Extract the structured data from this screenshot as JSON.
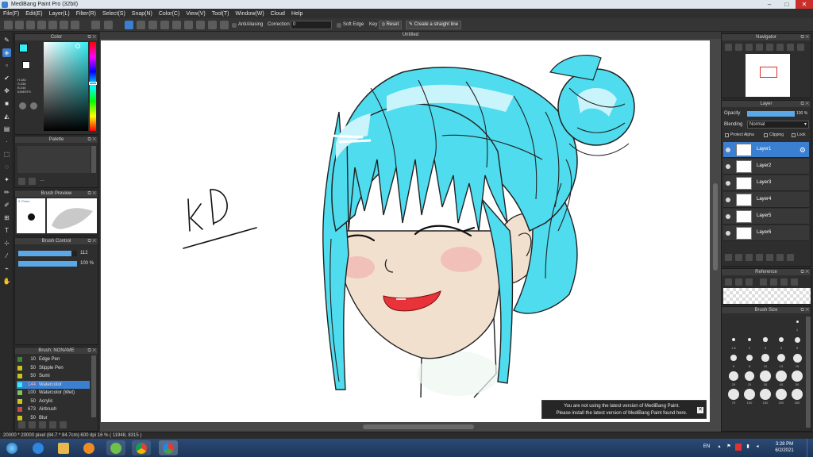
{
  "window": {
    "title": "MediBang Paint Pro (32bit)",
    "min": "–",
    "max": "□",
    "close": "✕"
  },
  "menu": [
    "File(F)",
    "Edit(E)",
    "Layer(L)",
    "Filter(R)",
    "Select(S)",
    "Snap(N)",
    "Color(C)",
    "View(V)",
    "Tool(T)",
    "Window(W)",
    "Cloud",
    "Help"
  ],
  "toolbar": {
    "antialiasing": "AntiAliasing",
    "correction_label": "Correction",
    "correction_value": "0",
    "soft_edge": "Soft Edge",
    "key_label": "Key",
    "reset": "Reset",
    "straight_line": "Create a straight line"
  },
  "document": {
    "tab": "Untitled"
  },
  "color_panel": {
    "title": "Color",
    "readout": [
      "H:184",
      "S:238",
      "B:246"
    ],
    "hex": "#36EEF5",
    "fg_color": "#36eef5",
    "bg_color": "#ffffff"
  },
  "palette_panel": {
    "title": "Palette"
  },
  "brush_preview": {
    "title": "Brush Preview",
    "size": "5.70mm"
  },
  "brush_control": {
    "title": "Brush Control",
    "size_value": "112",
    "opacity_value": "100 %",
    "size_fraction": 0.9,
    "opacity_fraction": 1.0
  },
  "brush_panel": {
    "title": "Brush: NONAME",
    "items": [
      {
        "size": "10",
        "name": "Edge Pen",
        "color": "#3a8a2e"
      },
      {
        "size": "50",
        "name": "Stipple Pen",
        "color": "#c9c31c"
      },
      {
        "size": "50",
        "name": "Sumi",
        "color": "#c9c31c"
      },
      {
        "size": "144",
        "name": "Watercolor",
        "color": "#36eef5",
        "selected": true
      },
      {
        "size": "100",
        "name": "Watercolor (Wet)",
        "color": "#7ec25a"
      },
      {
        "size": "50",
        "name": "Acrylic",
        "color": "#c9c31c"
      },
      {
        "size": "673",
        "name": "Airbrush",
        "color": "#c94a4a"
      },
      {
        "size": "50",
        "name": "Blur",
        "color": "#c9c31c"
      }
    ]
  },
  "navigator": {
    "title": "Navigator"
  },
  "layer_panel": {
    "title": "Layer",
    "opacity_label": "Opacity",
    "opacity_value": "100 %",
    "opacity_fraction": 1.0,
    "blending_label": "Blending",
    "blending_value": "Normal",
    "protect_alpha": "Protect Alpha",
    "clipping": "Clipping",
    "lock": "Lock",
    "layers": [
      "Layer1",
      "Layer2",
      "Layer3",
      "Layer4",
      "Layer5",
      "Layer6"
    ],
    "selected": "Layer1"
  },
  "reference": {
    "title": "Reference"
  },
  "brush_size": {
    "title": "Brush Size",
    "sizes": [
      "1",
      "1.5",
      "2",
      "3",
      "4",
      "5",
      "6",
      "8",
      "10",
      "13",
      "15",
      "20",
      "25",
      "30",
      "40",
      "50",
      "70",
      "100",
      "150",
      "200",
      "300"
    ]
  },
  "notice": {
    "line1": "You are not using the latest version of MediBang Paint.",
    "line2": "Please install the latest version of MediBang Paint found here.",
    "close": "✕"
  },
  "status": {
    "text": "20000 * 20000 pixel  (84.7 * 84.7cm)  600 dpi  16 %  ( 11948, 8315 )"
  },
  "artwork": {
    "signature": "KD",
    "hair_color": "#4fdcef",
    "hair_light": "#c9f4fb",
    "skin": "#f2e0cf",
    "lips": "#e8333a"
  },
  "taskbar": {
    "lang": "EN",
    "time": "3:28 PM",
    "date": "6/2/2021"
  }
}
